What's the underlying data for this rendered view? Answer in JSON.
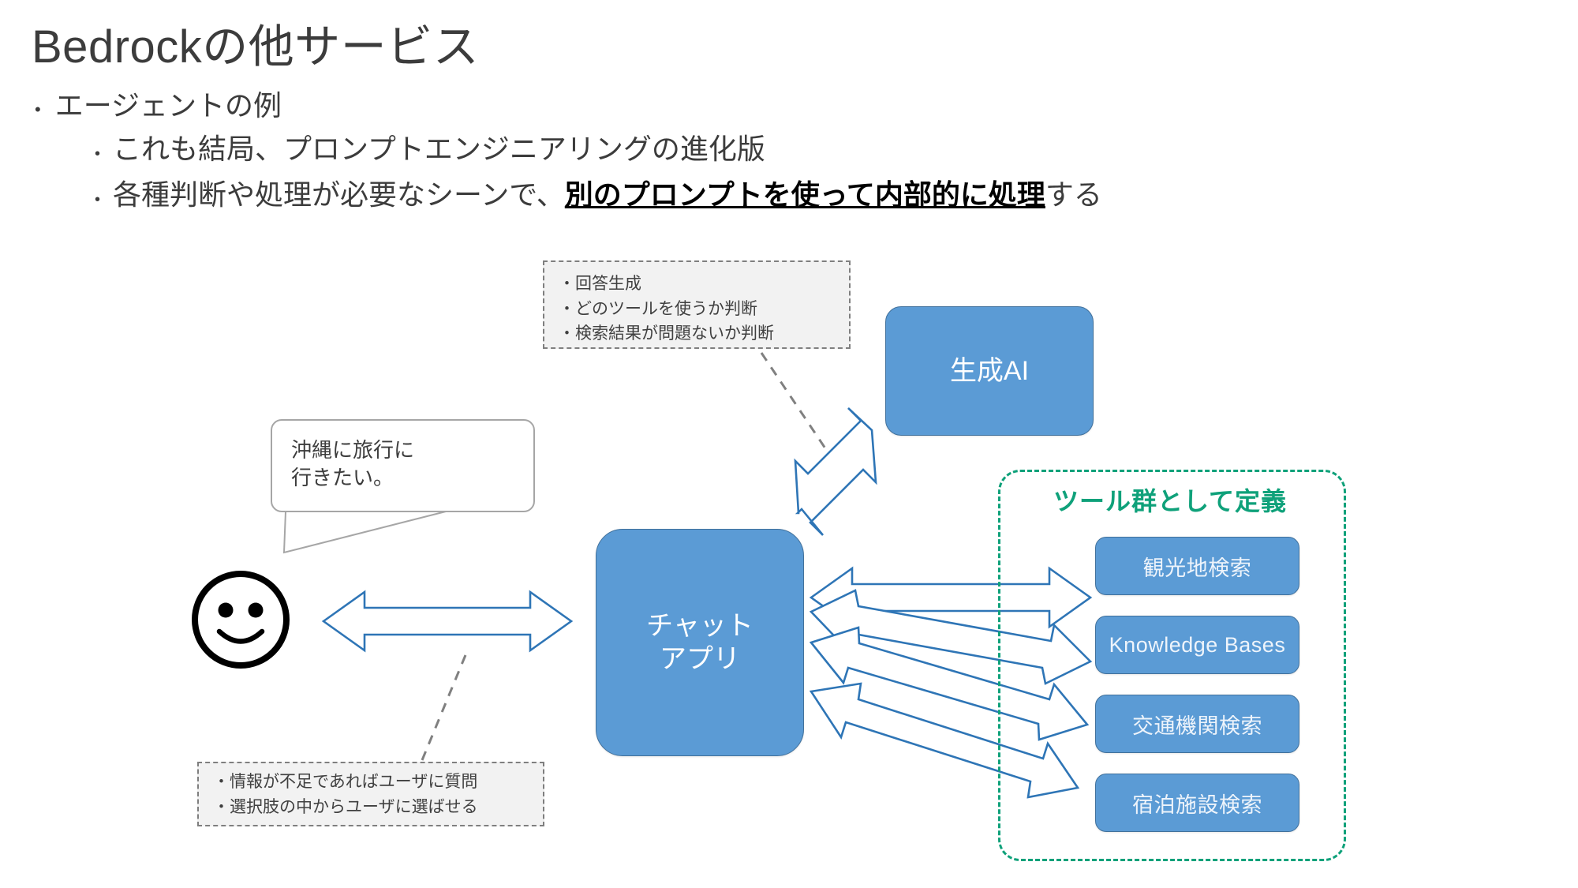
{
  "slide": {
    "title": "Bedrockの他サービス",
    "bullets": [
      {
        "level": 1,
        "marker": "•",
        "text": "エージェントの例"
      },
      {
        "level": 2,
        "marker": "•",
        "text": "これも結局、プロンプトエンジニアリングの進化版"
      }
    ],
    "bullet_mixed": {
      "marker": "•",
      "prefix": "各種判断や処理が必要なシーンで、",
      "emphasis": "別のプロンプトを使って内部的に処理",
      "suffix": "する"
    }
  },
  "diagram": {
    "genai_box": {
      "label": "生成AI"
    },
    "chat_app_box": {
      "line1": "チャット",
      "line2": "アプリ"
    },
    "tools_group": {
      "label": "ツール群として定義",
      "items": [
        {
          "label": "観光地検索"
        },
        {
          "label": "Knowledge Bases"
        },
        {
          "label": "交通機関検索"
        },
        {
          "label": "宿泊施設検索"
        }
      ]
    },
    "speech_bubble": {
      "line1": "沖縄に旅行に",
      "line2": "行きたい。"
    },
    "note_top": {
      "lines": [
        "・回答生成",
        "・どのツールを使うか判断",
        "・検索結果が問題ないか判断"
      ]
    },
    "note_bottom": {
      "lines": [
        "・情報が不足であればユーザに質問",
        "・選択肢の中からユーザに選ばせる"
      ]
    },
    "user_icon": "smiley-face-icon"
  },
  "colors": {
    "box_fill": "#5B9BD5",
    "box_stroke": "#41719C",
    "tools_group_accent": "#0FA17A",
    "arrow_stroke": "#2E75B6",
    "note_fill": "#F2F2F2",
    "note_stroke": "#7F7F7F",
    "bubble_stroke": "#A6A6A6",
    "text": "#3C3C3C"
  }
}
